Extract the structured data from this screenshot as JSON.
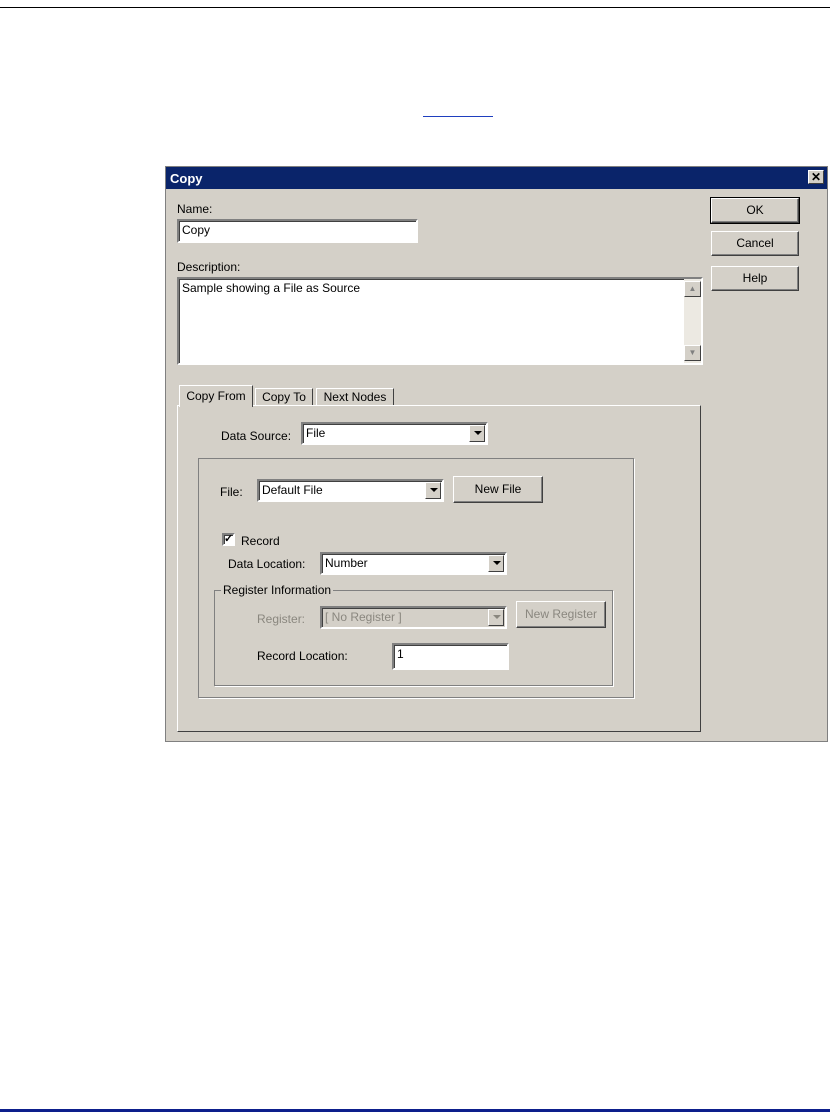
{
  "dialog": {
    "title": "Copy",
    "close_glyph": "✕",
    "name_label": "Name:",
    "name_value": "Copy",
    "description_label": "Description:",
    "description_value": "Sample showing a File as Source",
    "ok_label": "OK",
    "cancel_label": "Cancel",
    "help_label": "Help"
  },
  "tabs": [
    {
      "label": "Copy From",
      "active": true
    },
    {
      "label": "Copy To",
      "active": false
    },
    {
      "label": "Next Nodes",
      "active": false
    }
  ],
  "copy_from": {
    "data_source_label": "Data Source:",
    "data_source_value": "File",
    "file_label": "File:",
    "file_value": "Default File",
    "new_file_label": "New File",
    "record_label": "Record",
    "record_checked": true,
    "check_glyph": "✓",
    "data_location_label": "Data Location:",
    "data_location_value": "Number",
    "register_group_label": "Register Information",
    "register_label": "Register:",
    "register_value": "[ No Register ]",
    "new_register_label": "New Register",
    "record_location_label": "Record Location:",
    "record_location_value": "1"
  },
  "colors": {
    "titlebar": "#0a246a",
    "dialog_face": "#d4d0c8",
    "bottom_rule": "#0d1f8c"
  }
}
